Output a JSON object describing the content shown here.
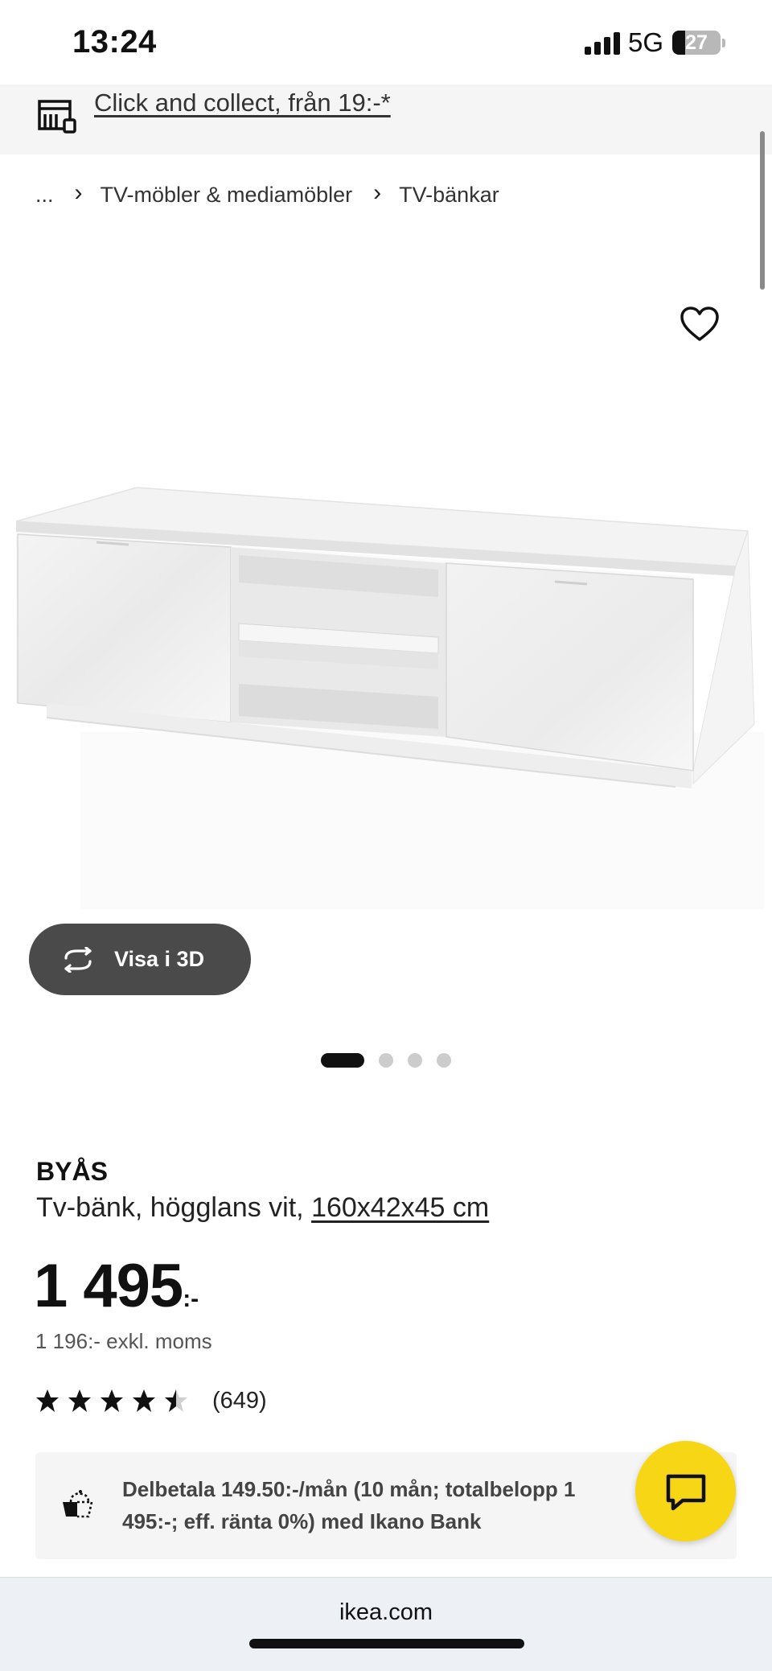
{
  "status_bar": {
    "time": "13:24",
    "network": "5G",
    "battery": "27",
    "battery_level": 0.27
  },
  "collect_banner": {
    "icon": "store-icon",
    "link_text": "Click and collect, från 19:-*"
  },
  "breadcrumb": {
    "items": [
      "...",
      "TV-möbler & mediamöbler",
      "TV-bänkar"
    ],
    "separator_icon": "chevron-right-icon"
  },
  "favorite": {
    "icon": "heart-icon"
  },
  "gallery": {
    "view_3d_label": "Visa i 3D",
    "view_3d_icon": "rotate-icon",
    "image_count": 4,
    "active_index": 0
  },
  "product": {
    "name": "BYÅS",
    "description": "Tv-bänk, högglans vit,",
    "dimensions": "160x42x45 cm",
    "price": "1 495",
    "price_suffix": ":-",
    "price_ex_vat": "1 196:- exkl. moms",
    "rating": 4.5,
    "rating_max": 5,
    "review_count": "(649)"
  },
  "financing": {
    "icon": "piggy-bank-icon",
    "text": "Delbetala 149.50:-/mån (10 mån; totalbelopp 1 495:-; eff. ränta 0%) med Ikano Bank"
  },
  "chat": {
    "icon": "chat-icon"
  },
  "browser": {
    "url": "ikea.com"
  },
  "colors": {
    "accent_yellow": "#f7d715",
    "dark_button": "#4a4a4a",
    "banner_bg": "#f5f5f5"
  }
}
